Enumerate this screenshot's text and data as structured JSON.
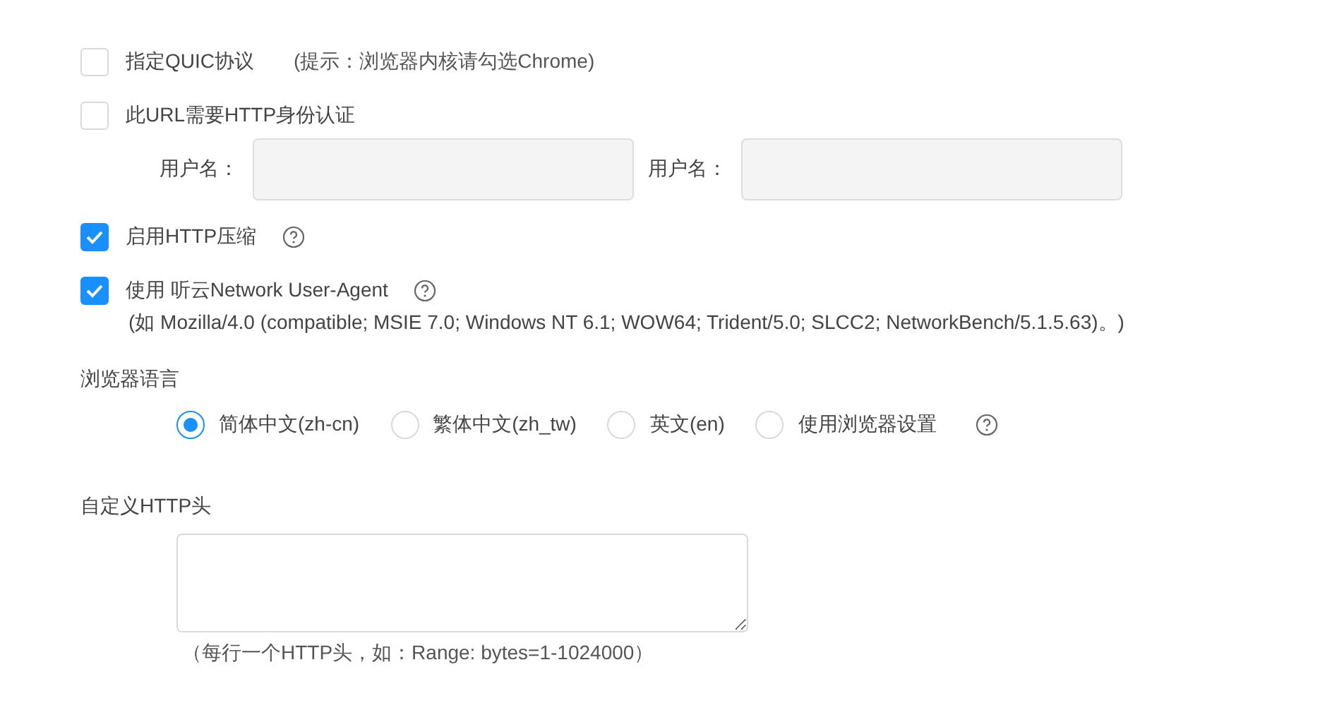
{
  "options": [
    {
      "label": "指定QUIC协议",
      "checked": false,
      "hint": "(提示：浏览器内核请勾选Chrome)"
    },
    {
      "label": "此URL需要HTTP身份认证",
      "checked": false,
      "fields": [
        {
          "label": "用户名："
        },
        {
          "label": "用户名："
        }
      ]
    },
    {
      "label": "启用HTTP压缩",
      "checked": true,
      "help": true
    },
    {
      "label": "使用 听云Network User-Agent",
      "checked": true,
      "help": true,
      "note": "(如 Mozilla/4.0 (compatible; MSIE 7.0; Windows NT 6.1; WOW64; Trident/5.0; SLCC2; NetworkBench/5.1.5.63)。)"
    }
  ],
  "language": {
    "title": "浏览器语言",
    "help": true,
    "options": [
      {
        "label": "简体中文(zh-cn)",
        "selected": true
      },
      {
        "label": "繁体中文(zh_tw)",
        "selected": false
      },
      {
        "label": "英文(en)",
        "selected": false
      },
      {
        "label": "使用浏览器设置",
        "selected": false
      }
    ]
  },
  "custom_header": {
    "title": "自定义HTTP头",
    "hint": "（每行一个HTTP头，如：Range: bytes=1-1024000）"
  }
}
